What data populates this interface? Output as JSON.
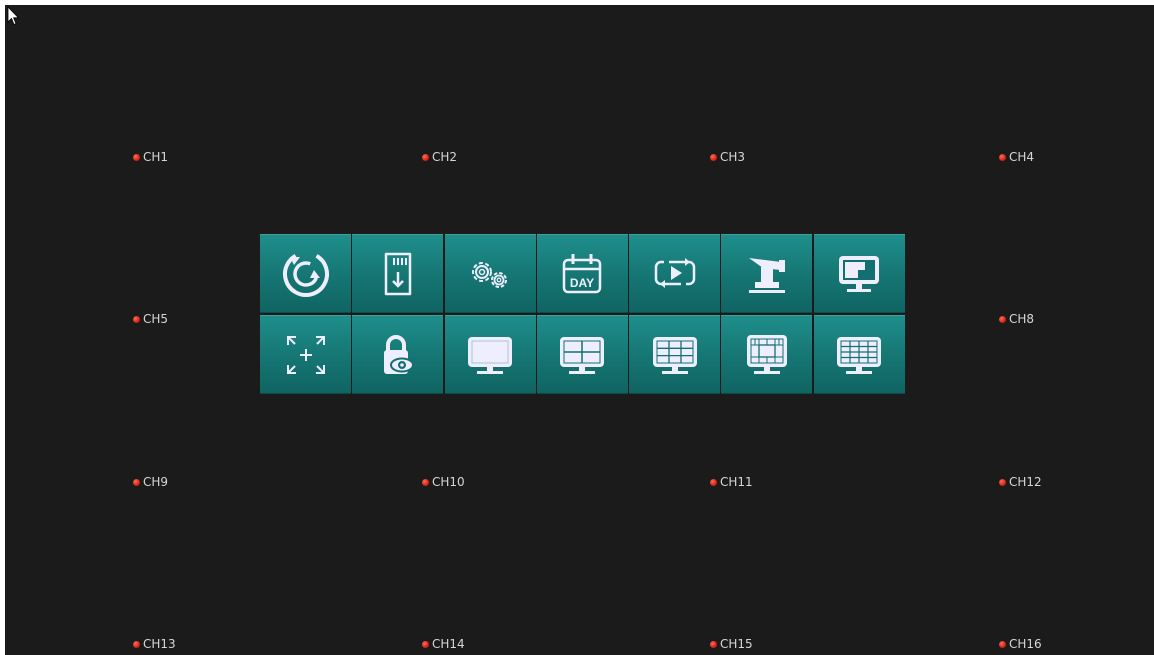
{
  "channels": [
    {
      "label": "CH1",
      "status": "red"
    },
    {
      "label": "CH2",
      "status": "red"
    },
    {
      "label": "CH3",
      "status": "red"
    },
    {
      "label": "CH4",
      "status": "red"
    },
    {
      "label": "CH5",
      "status": "red"
    },
    {
      "label": "CH8",
      "status": "red"
    },
    {
      "label": "CH9",
      "status": "red"
    },
    {
      "label": "CH10",
      "status": "red"
    },
    {
      "label": "CH11",
      "status": "red"
    },
    {
      "label": "CH12",
      "status": "red"
    },
    {
      "label": "CH13",
      "status": "red"
    },
    {
      "label": "CH14",
      "status": "red"
    },
    {
      "label": "CH15",
      "status": "red"
    },
    {
      "label": "CH16",
      "status": "red"
    }
  ],
  "quick_menu": {
    "row1": [
      "power-cycle-icon",
      "sd-card-backup-icon",
      "settings-gears-icon",
      "day-calendar-icon",
      "playback-loop-icon",
      "ptz-camera-icon",
      "pip-display-icon"
    ],
    "row2": [
      "zoom-expand-icon",
      "lock-view-icon",
      "single-screen-icon",
      "quad-screen-icon",
      "nine-screen-icon",
      "custom-split-screen-icon",
      "sixteen-screen-icon"
    ],
    "calendar_text": "DAY"
  },
  "colors": {
    "background": "#1b1b1b",
    "tile": "#167a77",
    "status_dot": "#e0261a",
    "label": "#d6d6d6"
  }
}
